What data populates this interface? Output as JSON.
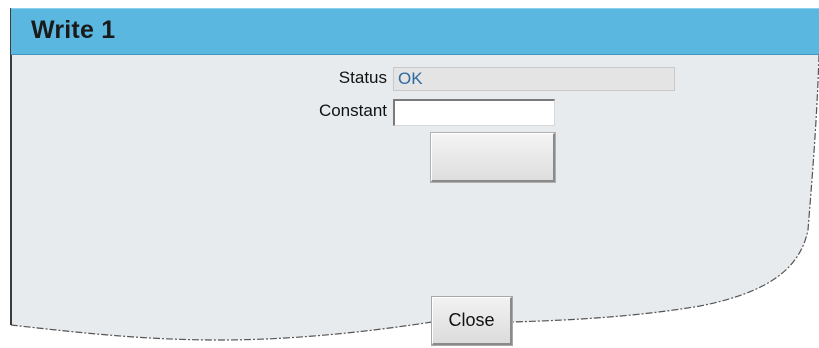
{
  "window": {
    "title": "Write 1"
  },
  "form": {
    "status_label": "Status",
    "status_value": "OK",
    "constant_label": "Constant",
    "constant_value": "",
    "write_button_label": "",
    "close_button_label": "Close"
  },
  "colors": {
    "titlebar": "#5ab8e0",
    "panel": "#e8ebee",
    "status_text": "#2d6a9f"
  }
}
